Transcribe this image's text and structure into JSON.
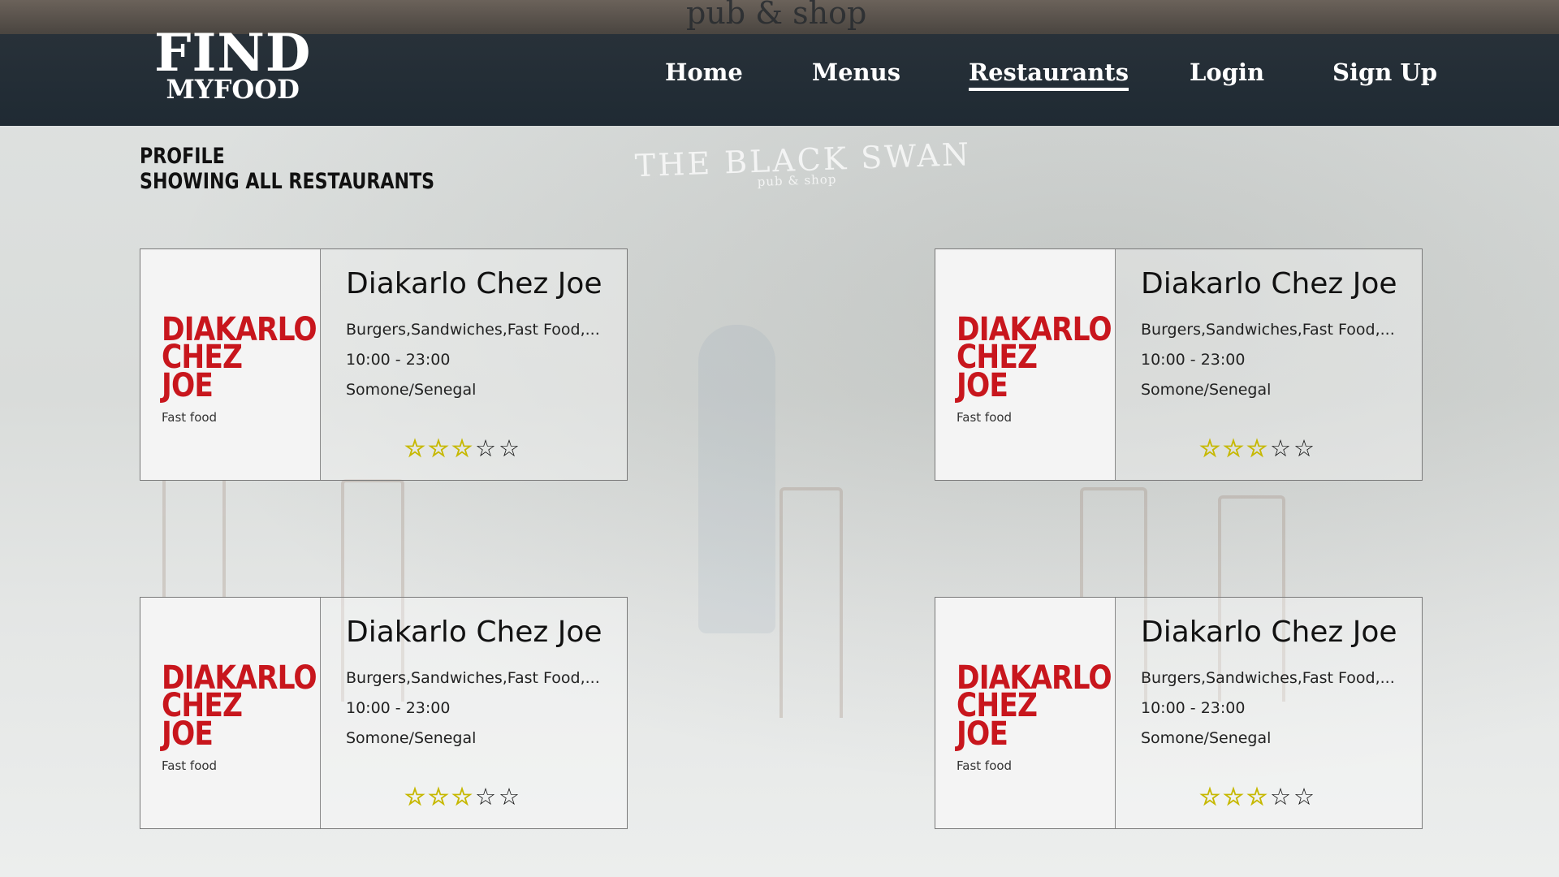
{
  "header": {
    "storefront_text": "pub & shop",
    "logo": {
      "line1": "FIND",
      "line2": "MYFOOD"
    },
    "nav": [
      {
        "label": "Home"
      },
      {
        "label": "Menus"
      },
      {
        "label": "Restaurants",
        "active": true
      },
      {
        "label": "Login"
      },
      {
        "label": "Sign Up"
      }
    ]
  },
  "background": {
    "sign_title": "THE BLACK SWAN",
    "sign_subtitle": "pub & shop"
  },
  "page": {
    "title_line1": "PROFILE",
    "title_line2": "SHOWING ALL RESTAURANTS"
  },
  "colors": {
    "brand_red": "#c8161d",
    "star_filled": "#f2f200",
    "header_bg": "#1f2a33"
  },
  "restaurants": [
    {
      "logo_line1": "DIAKARLO",
      "logo_line2": "CHEZ",
      "logo_line3": "JOE",
      "logo_tagline": "Fast food",
      "name": "Diakarlo Chez Joe",
      "cuisines": "Burgers,Sandwiches,Fast Food,...",
      "hours": "10:00 - 23:00",
      "location": "Somone/Senegal",
      "rating": 3,
      "rating_max": 5,
      "star_filled": "☆",
      "star_empty": "☆"
    },
    {
      "logo_line1": "DIAKARLO",
      "logo_line2": "CHEZ",
      "logo_line3": "JOE",
      "logo_tagline": "Fast food",
      "name": "Diakarlo Chez Joe",
      "cuisines": "Burgers,Sandwiches,Fast Food,...",
      "hours": "10:00 - 23:00",
      "location": "Somone/Senegal",
      "rating": 3,
      "rating_max": 5,
      "star_filled": "☆",
      "star_empty": "☆"
    },
    {
      "logo_line1": "DIAKARLO",
      "logo_line2": "CHEZ",
      "logo_line3": "JOE",
      "logo_tagline": "Fast food",
      "name": "Diakarlo Chez Joe",
      "cuisines": "Burgers,Sandwiches,Fast Food,...",
      "hours": "10:00 - 23:00",
      "location": "Somone/Senegal",
      "rating": 3,
      "rating_max": 5,
      "star_filled": "☆",
      "star_empty": "☆"
    },
    {
      "logo_line1": "DIAKARLO",
      "logo_line2": "CHEZ",
      "logo_line3": "JOE",
      "logo_tagline": "Fast food",
      "name": "Diakarlo Chez Joe",
      "cuisines": "Burgers,Sandwiches,Fast Food,...",
      "hours": "10:00 - 23:00",
      "location": "Somone/Senegal",
      "rating": 3,
      "rating_max": 5,
      "star_filled": "☆",
      "star_empty": "☆"
    }
  ]
}
